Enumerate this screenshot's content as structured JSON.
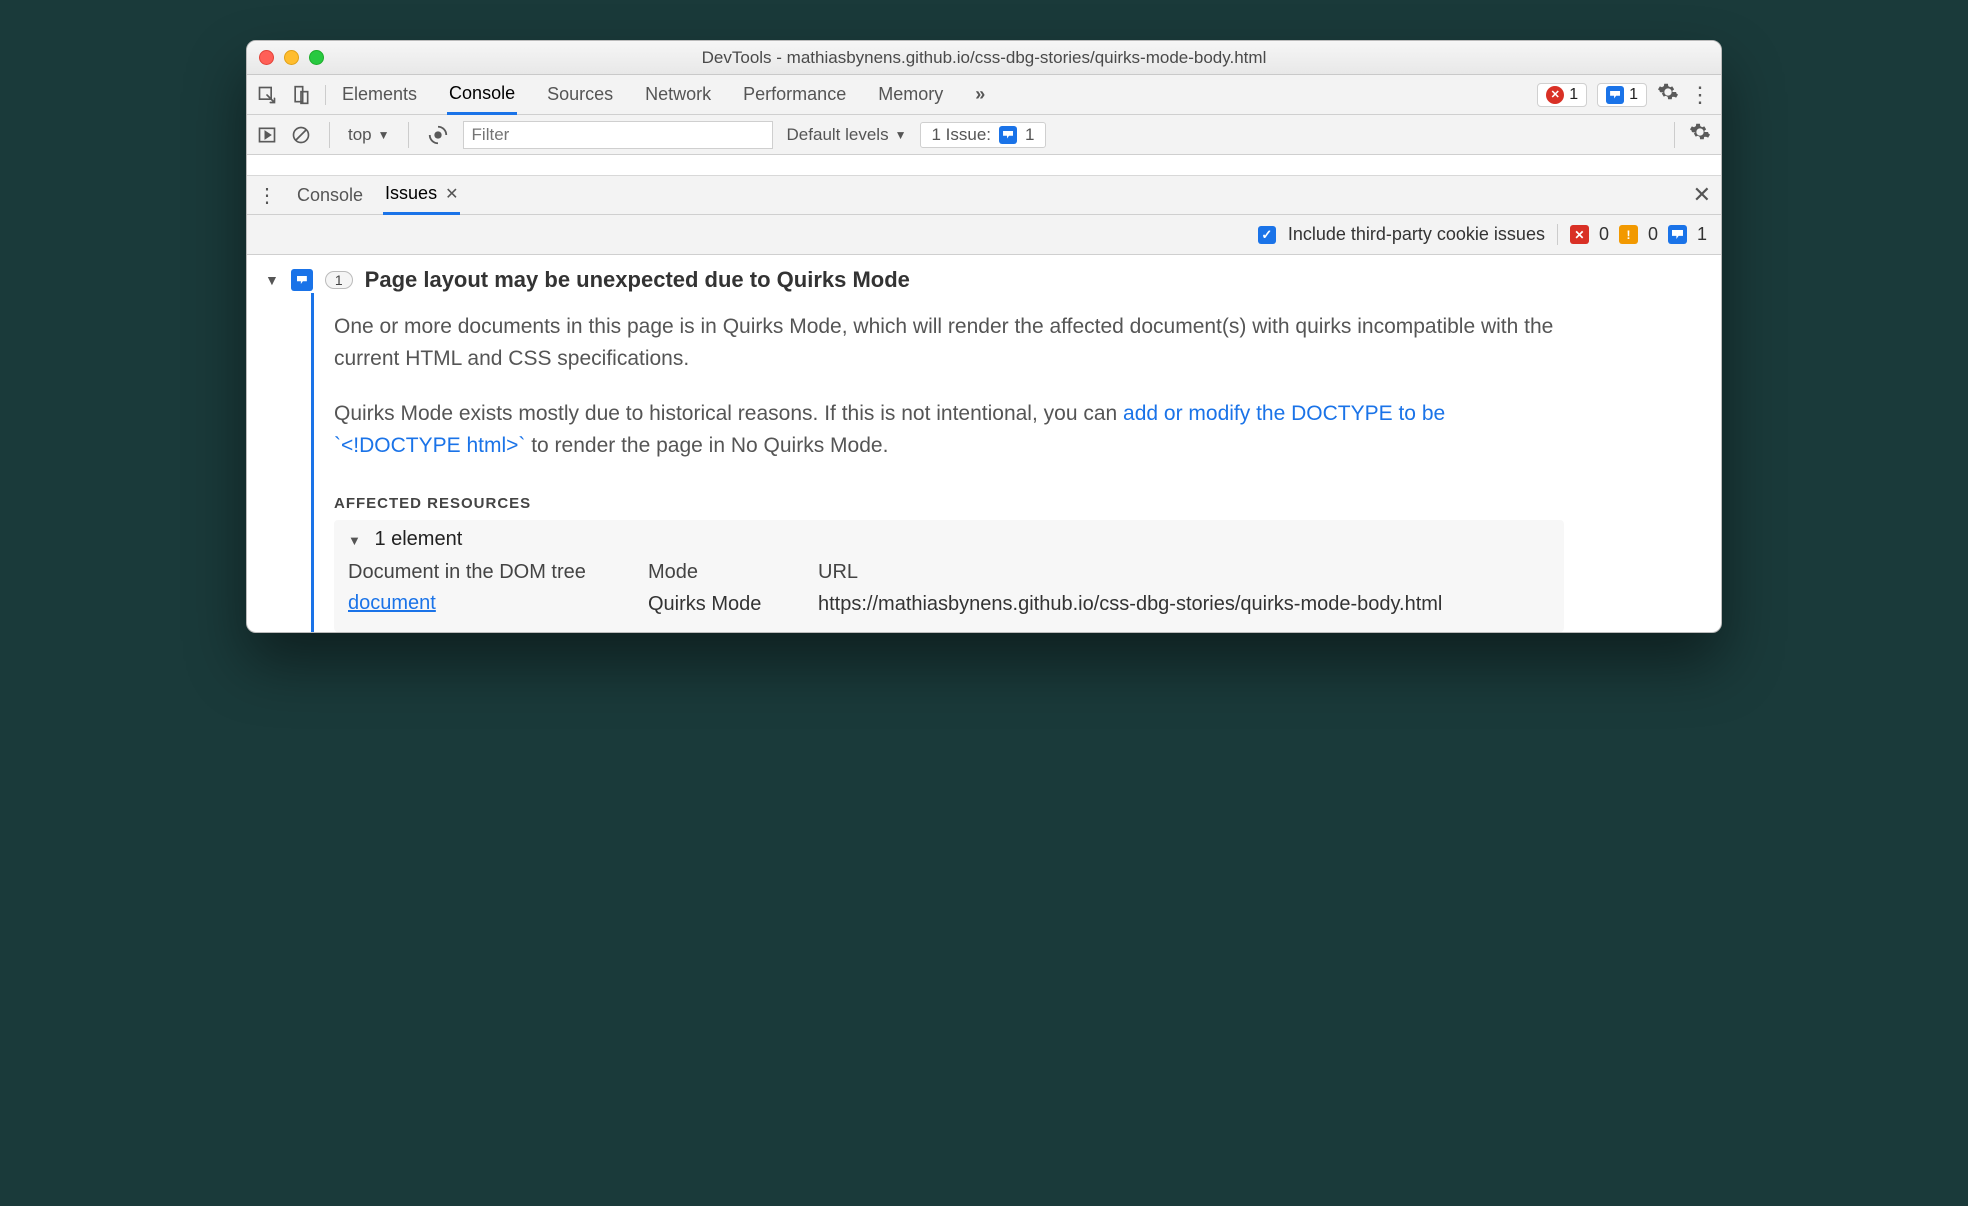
{
  "window": {
    "title": "DevTools - mathiasbynens.github.io/css-dbg-stories/quirks-mode-body.html"
  },
  "mainTabs": {
    "items": [
      "Elements",
      "Console",
      "Sources",
      "Network",
      "Performance",
      "Memory"
    ],
    "activeIndex": 1,
    "overflow": "»",
    "errorCount": "1",
    "issueCount": "1"
  },
  "consoleBar": {
    "context": "top",
    "filterPlaceholder": "Filter",
    "levels": "Default levels",
    "issueLabel": "1 Issue:",
    "issueNum": "1"
  },
  "drawer": {
    "tab1": "Console",
    "tab2": "Issues"
  },
  "issuesToolbar": {
    "checkboxLabel": "Include third-party cookie issues",
    "errCount": "0",
    "warnCount": "0",
    "infoCount": "1"
  },
  "issue": {
    "count": "1",
    "title": "Page layout may be unexpected due to Quirks Mode",
    "para1": "One or more documents in this page is in Quirks Mode, which will render the affected document(s) with quirks incompatible with the current HTML and CSS specifications.",
    "para2a": "Quirks Mode exists mostly due to historical reasons. If this is not intentional, you can ",
    "para2link": "add or modify the DOCTYPE to be `<!DOCTYPE html>`",
    "para2b": " to render the page in No Quirks Mode.",
    "affectedHeader": "AFFECTED RESOURCES",
    "elementLine": "1 element",
    "table": {
      "h1": "Document in the DOM tree",
      "h2": "Mode",
      "h3": "URL",
      "r1c1": "document",
      "r1c2": "Quirks Mode",
      "r1c3": "https://mathiasbynens.github.io/css-dbg-stories/quirks-mode-body.html"
    }
  }
}
